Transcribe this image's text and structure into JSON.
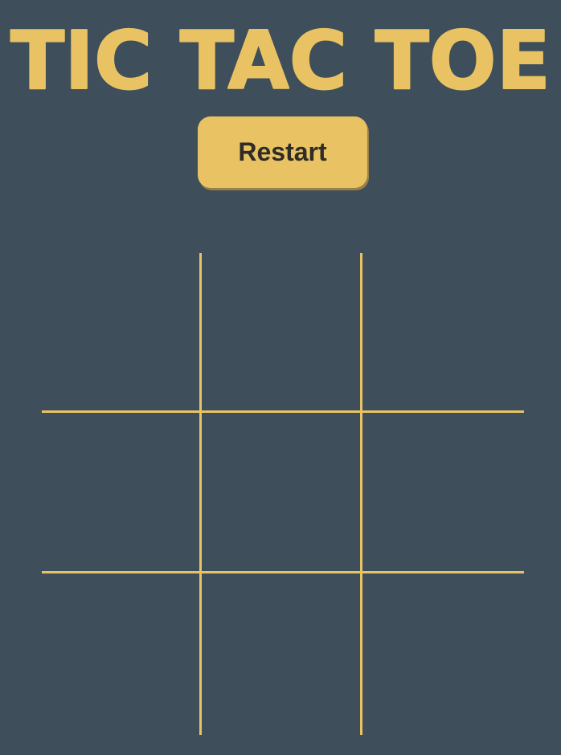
{
  "title": "TIC TAC TOE",
  "restart_label": "Restart",
  "colors": {
    "background": "#3e4f5b",
    "accent": "#e9c363",
    "button_text": "#2f2c25"
  },
  "board": {
    "cells": [
      "",
      "",
      "",
      "",
      "",
      "",
      "",
      "",
      ""
    ]
  }
}
